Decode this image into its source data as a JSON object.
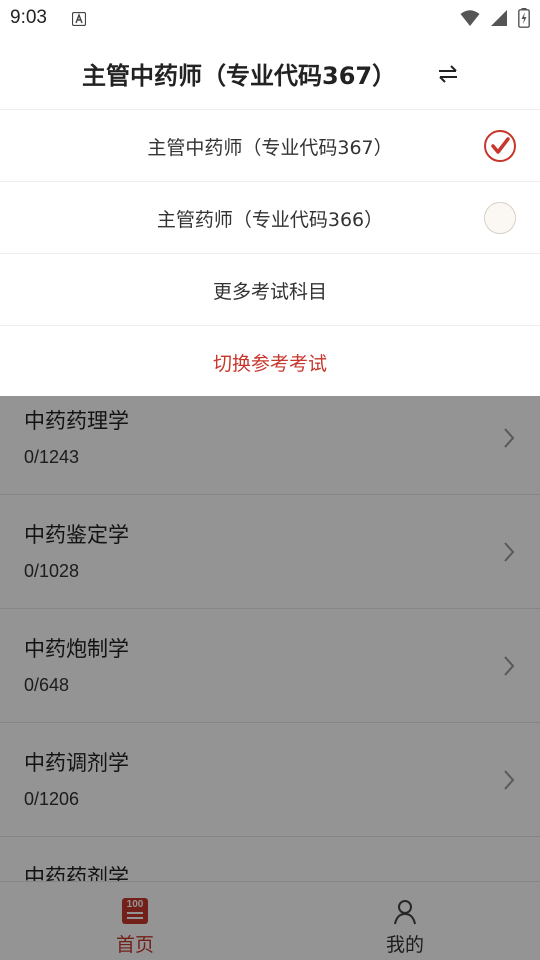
{
  "status_bar": {
    "time": "9:03",
    "icons": [
      "accessibility-a-icon",
      "wifi-icon",
      "signal-icon",
      "battery-charging-icon"
    ]
  },
  "dropdown": {
    "title": "主管中药师（专业代码367）",
    "swap_icon": "swap-arrows-icon",
    "options": [
      {
        "label": "主管中药师（专业代码367）",
        "selected": true
      },
      {
        "label": "主管药师（专业代码366）",
        "selected": false
      }
    ],
    "more_subjects_label": "更多考试科目",
    "switch_exam_label": "切换参考考试"
  },
  "subjects": [
    {
      "name": "中药药理学",
      "progress": "0/1243"
    },
    {
      "name": "中药鉴定学",
      "progress": "0/1028"
    },
    {
      "name": "中药炮制学",
      "progress": "0/648"
    },
    {
      "name": "中药调剂学",
      "progress": "0/1206"
    },
    {
      "name": "中药药剂学",
      "progress": ""
    }
  ],
  "tab_bar": {
    "home_label": "首页",
    "home_icon_text": "100",
    "mine_label": "我的"
  },
  "colors": {
    "accent": "#c8372d",
    "overlay": "rgba(0,0,0,0.42)"
  }
}
